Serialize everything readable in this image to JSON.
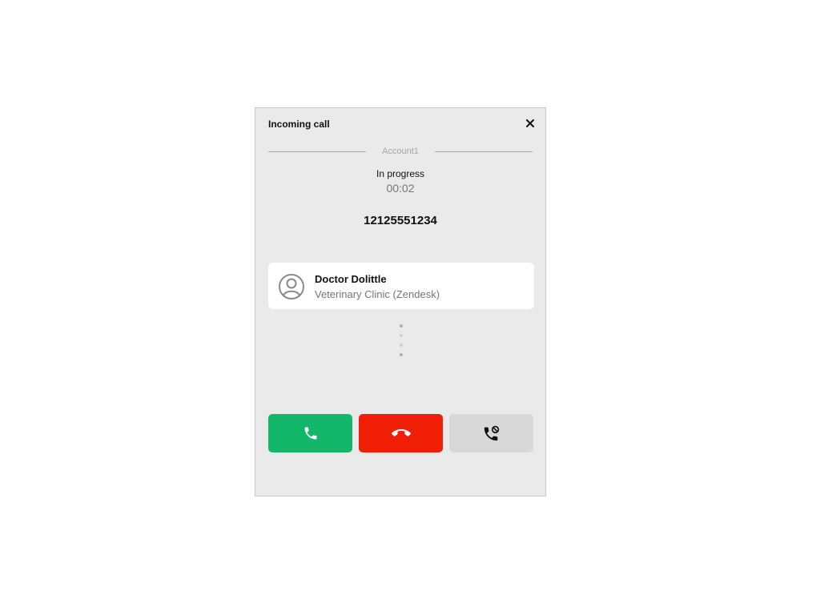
{
  "dialog": {
    "title": "Incoming call",
    "account": "Account1",
    "status": "In progress",
    "timer": "00:02",
    "phone_number": "12125551234"
  },
  "contact": {
    "name": "Doctor Dolittle",
    "company": "Veterinary Clinic (Zendesk)"
  },
  "actions": {
    "answer_icon": "phone-icon",
    "decline_icon": "hang-up-icon",
    "forward_icon": "phone-forward-icon"
  },
  "colors": {
    "answer": "#12b76a",
    "decline": "#f01e05",
    "forward": "#d8d8d8",
    "background": "#eaeaea"
  }
}
